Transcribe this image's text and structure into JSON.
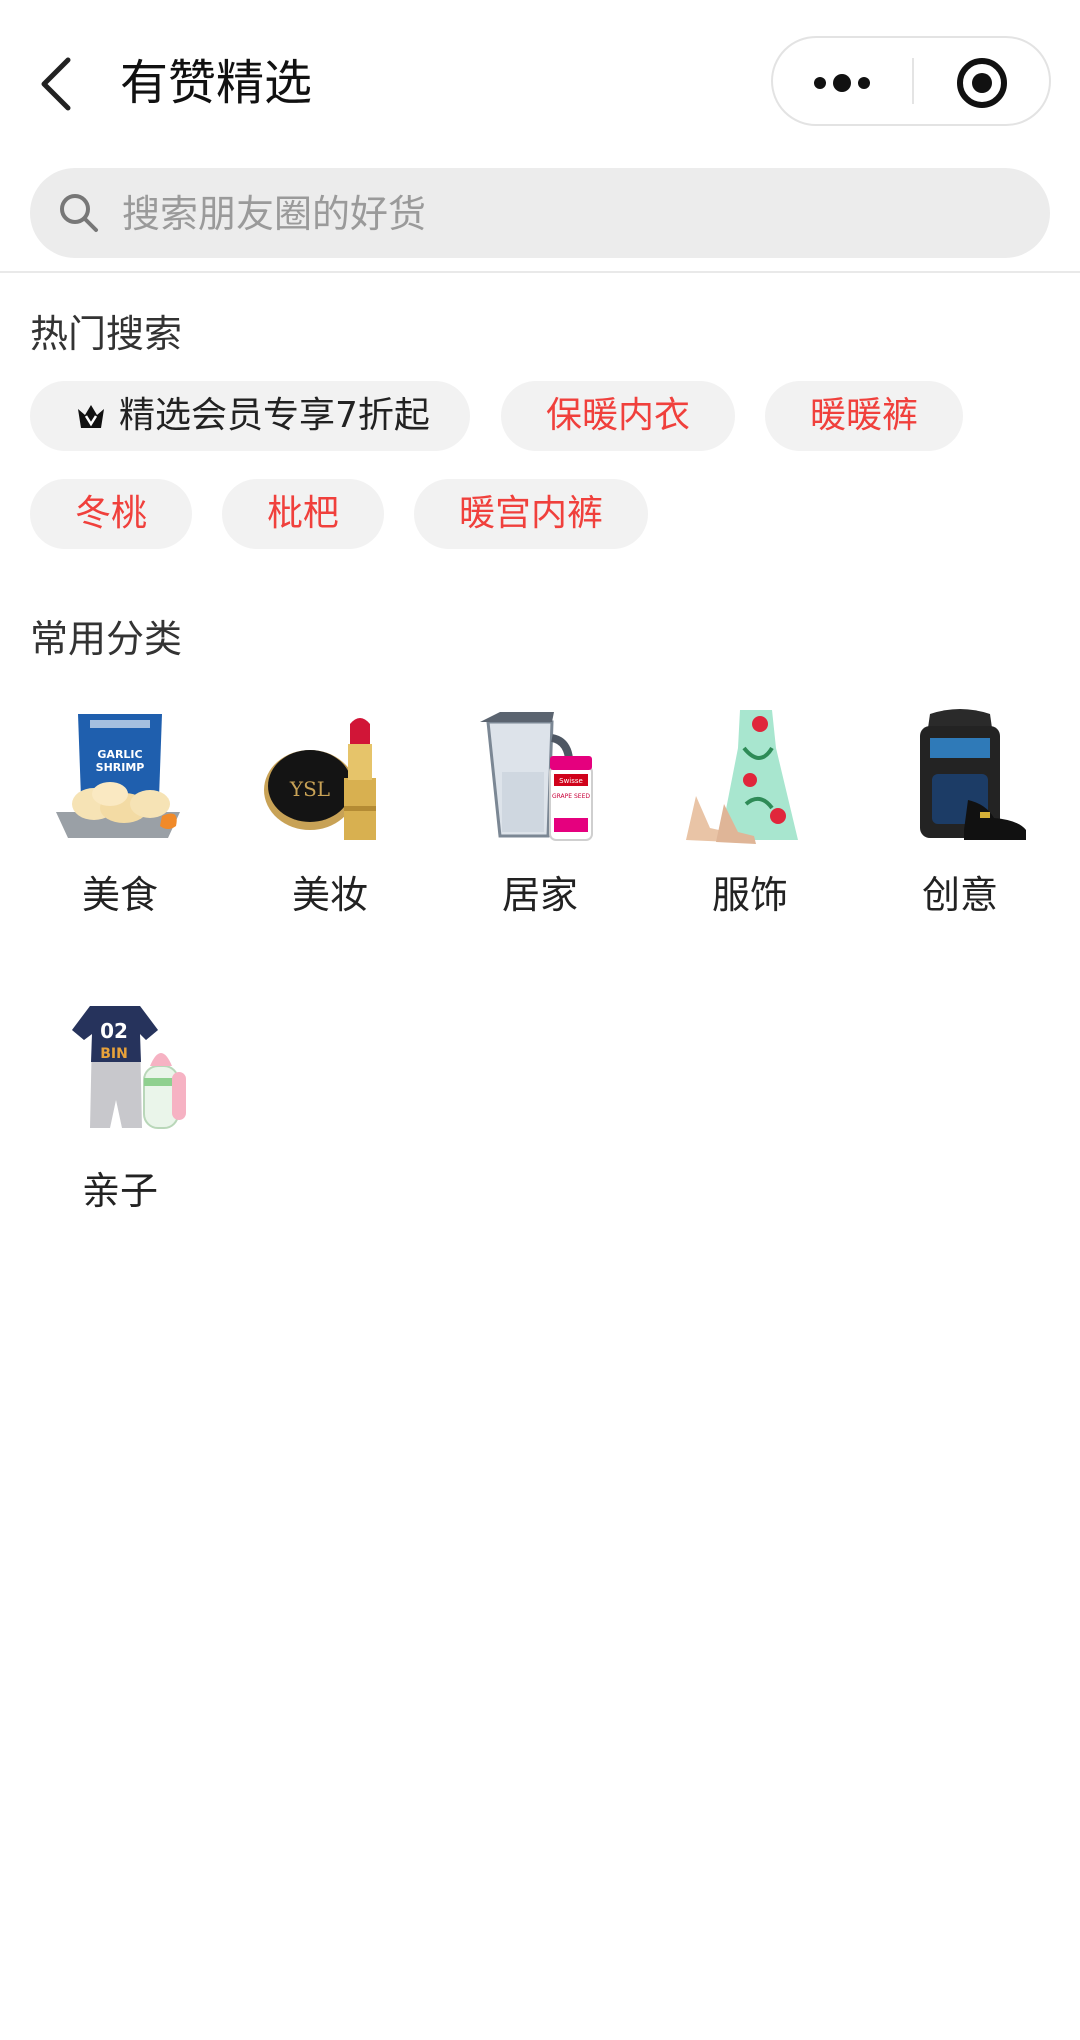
{
  "header": {
    "title": "有赞精选"
  },
  "search": {
    "placeholder": "搜索朋友圈的好货"
  },
  "hot_search": {
    "title": "热门搜索",
    "chips": [
      {
        "label": "精选会员专享7折起",
        "icon": "crown-icon",
        "color": "#222222"
      },
      {
        "label": "保暖内衣",
        "color": "#f0403c"
      },
      {
        "label": "暖暖裤",
        "color": "#f0403c"
      },
      {
        "label": "冬桃",
        "color": "#f0403c"
      },
      {
        "label": "枇杷",
        "color": "#f0403c"
      },
      {
        "label": "暖宫内裤",
        "color": "#f0403c"
      }
    ]
  },
  "categories": {
    "title": "常用分类",
    "items": [
      {
        "label": "美食",
        "icon": "garlic-shrimp-chips-image",
        "package_text": "GARLIC SHRIMP"
      },
      {
        "label": "美妆",
        "icon": "cushion-and-lipstick-image",
        "brand_text": "YSL"
      },
      {
        "label": "居家",
        "icon": "water-pitcher-and-supplement-image",
        "brand_text": "Swisse",
        "product_text": "GRAPE SEED"
      },
      {
        "label": "服饰",
        "icon": "dress-and-heels-image"
      },
      {
        "label": "创意",
        "icon": "backpack-and-sneaker-image"
      },
      {
        "label": "亲子",
        "icon": "baby-romper-and-bottle-image",
        "garment_text": "02 BIN"
      }
    ]
  },
  "colors": {
    "accent_red": "#f0403c",
    "chip_bg": "#f2f2f2",
    "search_bg": "#ececec"
  }
}
